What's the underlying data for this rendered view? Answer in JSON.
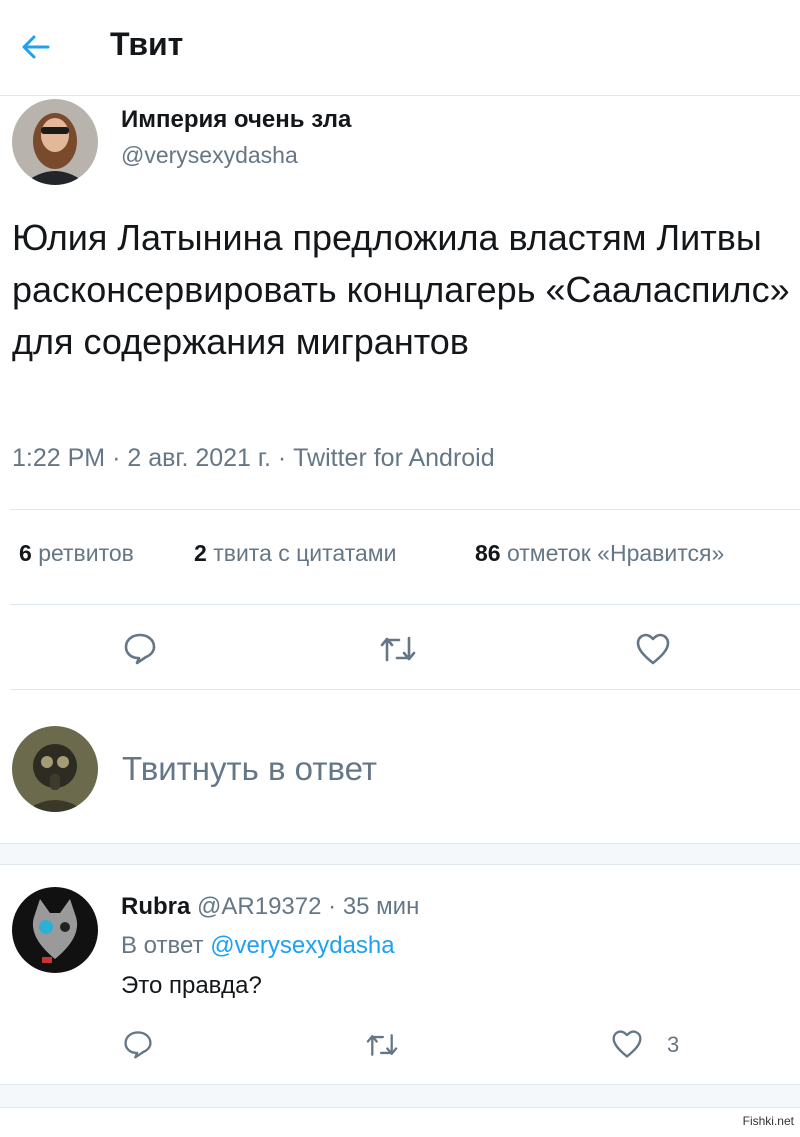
{
  "header": {
    "title": "Твит"
  },
  "tweet": {
    "author_name": "Империя очень зла",
    "author_handle": "@verysexydasha",
    "text": "Юлия Латынина предложила властям Литвы расконсервировать концлагерь «Сааласпилс» для содержания мигрантов",
    "time": "1:22 PM",
    "date": "2 авг. 2021 г.",
    "client": "Twitter for Android",
    "sep": "·",
    "stats": {
      "retweets_count": "6",
      "retweets_label": "ретвитов",
      "quotes_count": "2",
      "quotes_label": "твита с цитатами",
      "likes_count": "86",
      "likes_label": "отметок «Нравится»"
    },
    "icons": {
      "reply": "reply-icon",
      "retweet": "retweet-icon",
      "like": "heart-icon"
    }
  },
  "reply_box": {
    "placeholder": "Твитнуть в ответ"
  },
  "reply": {
    "author_name": "Rubra",
    "author_handle": "@AR19372",
    "age": "35 мин",
    "sep": "·",
    "in_reply_prefix": "В ответ",
    "in_reply_to": "@verysexydasha",
    "text": "Это правда?",
    "like_count": "3"
  },
  "watermark": "Fishki.net",
  "colors": {
    "accent": "#1da1f2",
    "secondary_text": "#657786",
    "divider": "#e1e8ed"
  }
}
